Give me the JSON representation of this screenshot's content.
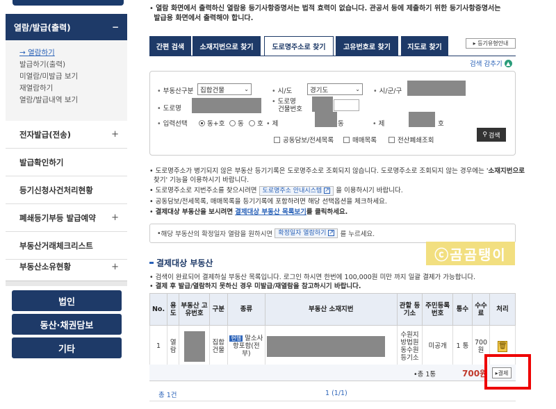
{
  "sidebar": {
    "open_menu": "열람/발급(출력)",
    "open_menu_toggle": "−",
    "sub_items": [
      "열람하기",
      "발급하기(출력)",
      "미열람/미발급 보기",
      "재열람하기",
      "열람/발급내역 보기"
    ],
    "items": [
      {
        "label": "전자발급(전송)",
        "toggle": "+"
      },
      {
        "label": "발급확인하기",
        "toggle": ""
      },
      {
        "label": "등기신청사건처리현황",
        "toggle": ""
      },
      {
        "label": "폐쇄등기부등 발급예약",
        "toggle": "+"
      },
      {
        "label": "부동산거래체크리스트",
        "toggle": ""
      },
      {
        "label": "부동산소유현황",
        "toggle": "+"
      }
    ],
    "buttons": [
      "법인",
      "동산·채권담보",
      "기타"
    ]
  },
  "notice_top": {
    "line1": "열람 화면에서 출력하신 열람용 등기사항증명서는 법적 효력이 없습니다. 관공서 등에 제출하기 위한 등기사항증명서는",
    "line2": "발급용 화면에서 출력해야 합니다."
  },
  "tabs": [
    "간편 검색",
    "소재지번으로 찾기",
    "도로명주소로 찾기",
    "고유번호로 찾기",
    "지도로 찾기"
  ],
  "help_button": "▸ 등기유형안내",
  "collapse_label": "검색 감추기",
  "search": {
    "realty_type_label": "부동산구분",
    "realty_type_value": "집합건물",
    "sido_label": "시/도",
    "sido_value": "경기도",
    "sigungu_label": "시/군/구",
    "road_label": "도로명",
    "building_no_label1": "도로명",
    "building_no_label2": "건물번호",
    "input_label": "입력선택",
    "radio_options": [
      "동+호",
      "동",
      "호"
    ],
    "dong_label": "제",
    "dong_suffix": "동",
    "ho_label": "제",
    "ho_suffix": "호",
    "checkboxes": [
      "공동담보/전세목록",
      "매매목록",
      "전산폐쇄조회"
    ],
    "search_button": "검색"
  },
  "notes": {
    "n1a": "도로명주소가 병기되지 않은 부동산 등기기록은 도로명주소로 조회되지 않습니다. 도로명주소로 조회되지 않는 경우에는 '",
    "n1b": "소재지번으로",
    "n1c": "찾기' 기능을 이용하시기 바랍니다.",
    "n2a": "도로명주소로 지번주소를 찾으시려면",
    "n2_btn": "도로명주소 안내시스템",
    "n2b": "을 이용하시기 바랍니다.",
    "n3": "공동담보/전세목록, 매매목록을 등기기록에 포함하려면 해당 선택옵션을 체크하세요.",
    "n4a": "결제대상 부동산을 보시려면",
    "n4_link": "결제대상 부동산 목록보기",
    "n4b": "를 클릭하세요."
  },
  "info_box": {
    "text_a": "해당 부동산의 확정일자 열람을 원하시면",
    "btn": "확정일자 열람하기",
    "text_b": "를 누르세요."
  },
  "watermark": "ⓒ곰곰탱이",
  "section": {
    "title": "결제대상 부동산",
    "note1": "검색이 완료되어 결제하실 부동산 목록입니다. 로그인 하시면 한번에 100,000원 미만 까지 일괄 결제가 가능합니다.",
    "note2": "결제 후 발급/열람하지 못하신 경우 미발급/재열람을 참고하시기 바랍니다."
  },
  "table": {
    "headers": [
      "No.",
      "용도",
      "부동산 고유번호",
      "구분",
      "종류",
      "부동산 소재지번",
      "관할 등기소",
      "주민등록번호",
      "통수",
      "수수료",
      "처리"
    ],
    "row": {
      "no": "1",
      "use": "열람",
      "kind": "집합건물",
      "type_tag": "현행",
      "type_text": "말소사항포함(전부)",
      "office": "수원지방법원동수원등기소",
      "resident_no": "미공개",
      "copies": "1 통",
      "fee": "700 원"
    }
  },
  "total": {
    "count": "•총 1통",
    "amount": "700원",
    "pay_button": "▸결제"
  },
  "footer": {
    "count": "총 1건",
    "page": "1 (1/1)"
  }
}
